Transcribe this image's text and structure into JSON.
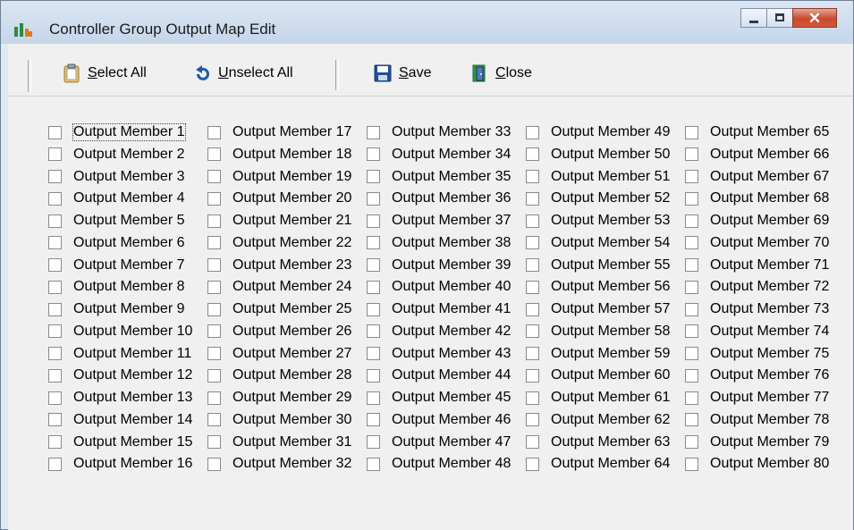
{
  "window": {
    "title": "Controller Group Output Map Edit",
    "controls": {
      "minimize": "minimize",
      "maximize": "maximize",
      "close": "✕"
    }
  },
  "toolbar": {
    "select_all": "Select All",
    "unselect_all": "Unselect All",
    "save": "Save",
    "close": "Close"
  },
  "members": [
    "Output Member 1",
    "Output Member 2",
    "Output Member 3",
    "Output Member 4",
    "Output Member 5",
    "Output Member 6",
    "Output Member 7",
    "Output Member 8",
    "Output Member 9",
    "Output Member 10",
    "Output Member 11",
    "Output Member 12",
    "Output Member 13",
    "Output Member 14",
    "Output Member 15",
    "Output Member 16",
    "Output Member 17",
    "Output Member 18",
    "Output Member 19",
    "Output Member 20",
    "Output Member 21",
    "Output Member 22",
    "Output Member 23",
    "Output Member 24",
    "Output Member 25",
    "Output Member 26",
    "Output Member 27",
    "Output Member 28",
    "Output Member 29",
    "Output Member 30",
    "Output Member 31",
    "Output Member 32",
    "Output Member 33",
    "Output Member 34",
    "Output Member 35",
    "Output Member 36",
    "Output Member 37",
    "Output Member 38",
    "Output Member 39",
    "Output Member 40",
    "Output Member 41",
    "Output Member 42",
    "Output Member 43",
    "Output Member 44",
    "Output Member 45",
    "Output Member 46",
    "Output Member 47",
    "Output Member 48",
    "Output Member 49",
    "Output Member 50",
    "Output Member 51",
    "Output Member 52",
    "Output Member 53",
    "Output Member 54",
    "Output Member 55",
    "Output Member 56",
    "Output Member 57",
    "Output Member 58",
    "Output Member 59",
    "Output Member 60",
    "Output Member 61",
    "Output Member 62",
    "Output Member 63",
    "Output Member 64",
    "Output Member 65",
    "Output Member 66",
    "Output Member 67",
    "Output Member 68",
    "Output Member 69",
    "Output Member 70",
    "Output Member 71",
    "Output Member 72",
    "Output Member 73",
    "Output Member 74",
    "Output Member 75",
    "Output Member 76",
    "Output Member 77",
    "Output Member 78",
    "Output Member 79",
    "Output Member 80"
  ],
  "checked": [],
  "focused_member": "Output Member 1",
  "colors": {
    "accent": "#1e5aa8",
    "close_button": "#c8492f"
  }
}
